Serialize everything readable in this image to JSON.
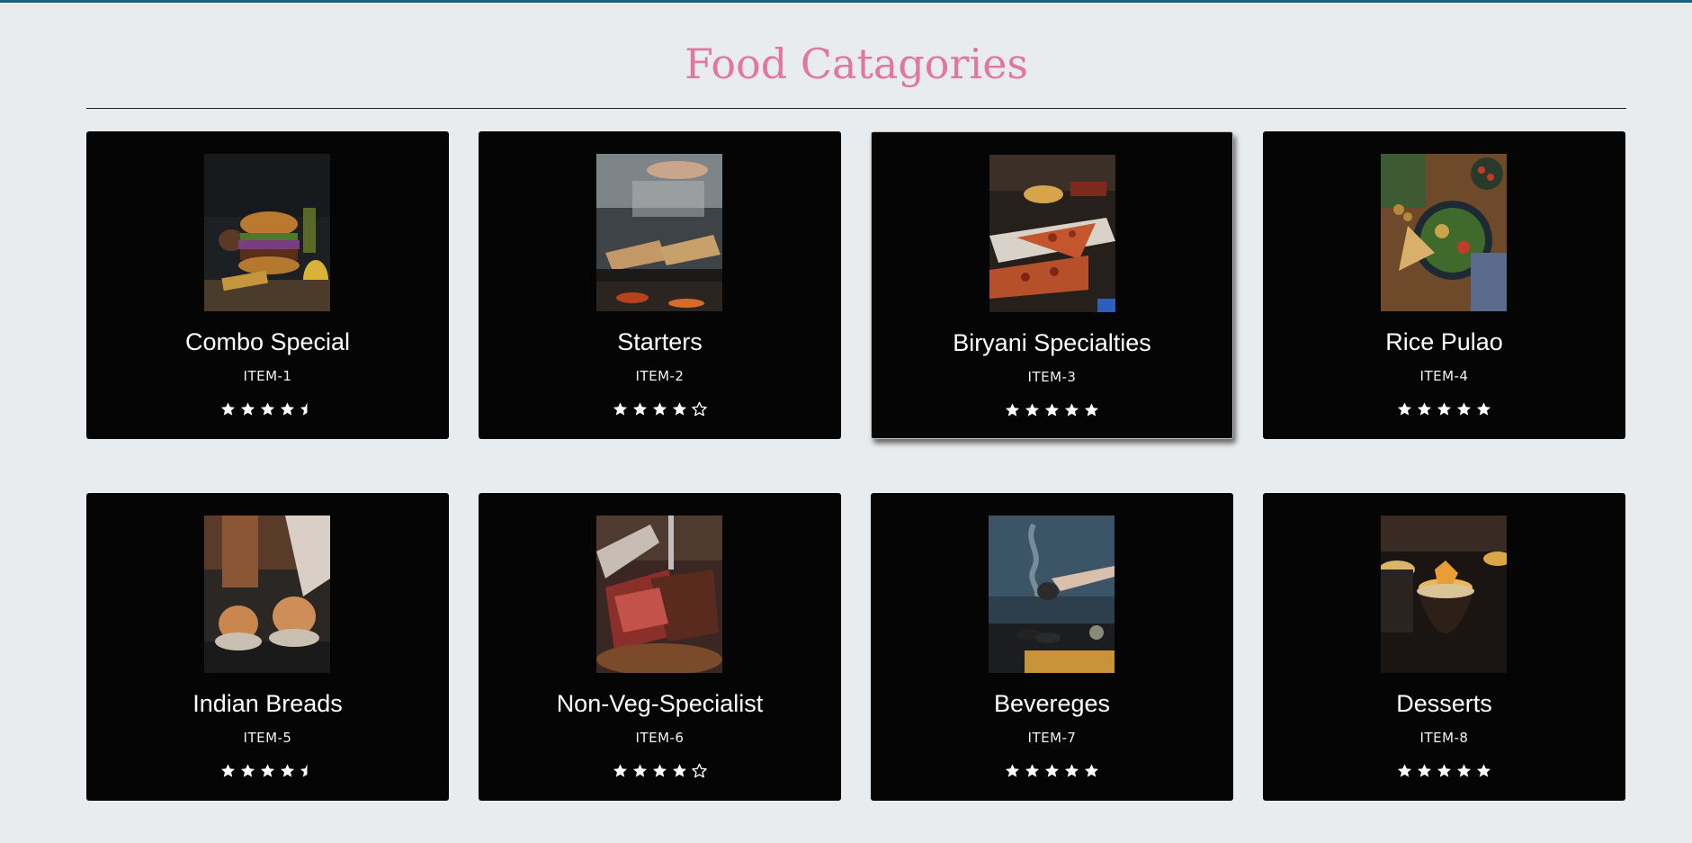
{
  "page": {
    "title": "Food Catagories",
    "accent": "#e0789d",
    "card_bg": "#050505",
    "strip": "#1c5f86"
  },
  "categories": [
    {
      "name": "Combo Special",
      "code": "ITEM-1",
      "rating": 4.5,
      "image": "burger-photo"
    },
    {
      "name": "Starters",
      "code": "ITEM-2",
      "rating": 4,
      "image": "grill-photo"
    },
    {
      "name": "Biryani Specialties",
      "code": "ITEM-3",
      "rating": 5,
      "image": "pizza-photo"
    },
    {
      "name": "Rice Pulao",
      "code": "ITEM-4",
      "rating": 5,
      "image": "salad-bowl-photo"
    },
    {
      "name": "Indian Breads",
      "code": "ITEM-5",
      "rating": 4.5,
      "image": "buns-photo"
    },
    {
      "name": "Non-Veg-Specialist",
      "code": "ITEM-6",
      "rating": 4,
      "image": "steak-photo"
    },
    {
      "name": "Bevereges",
      "code": "ITEM-7",
      "rating": 5,
      "image": "tea-pour-photo"
    },
    {
      "name": "Desserts",
      "code": "ITEM-8",
      "rating": 5,
      "image": "dessert-cup-photo"
    }
  ]
}
